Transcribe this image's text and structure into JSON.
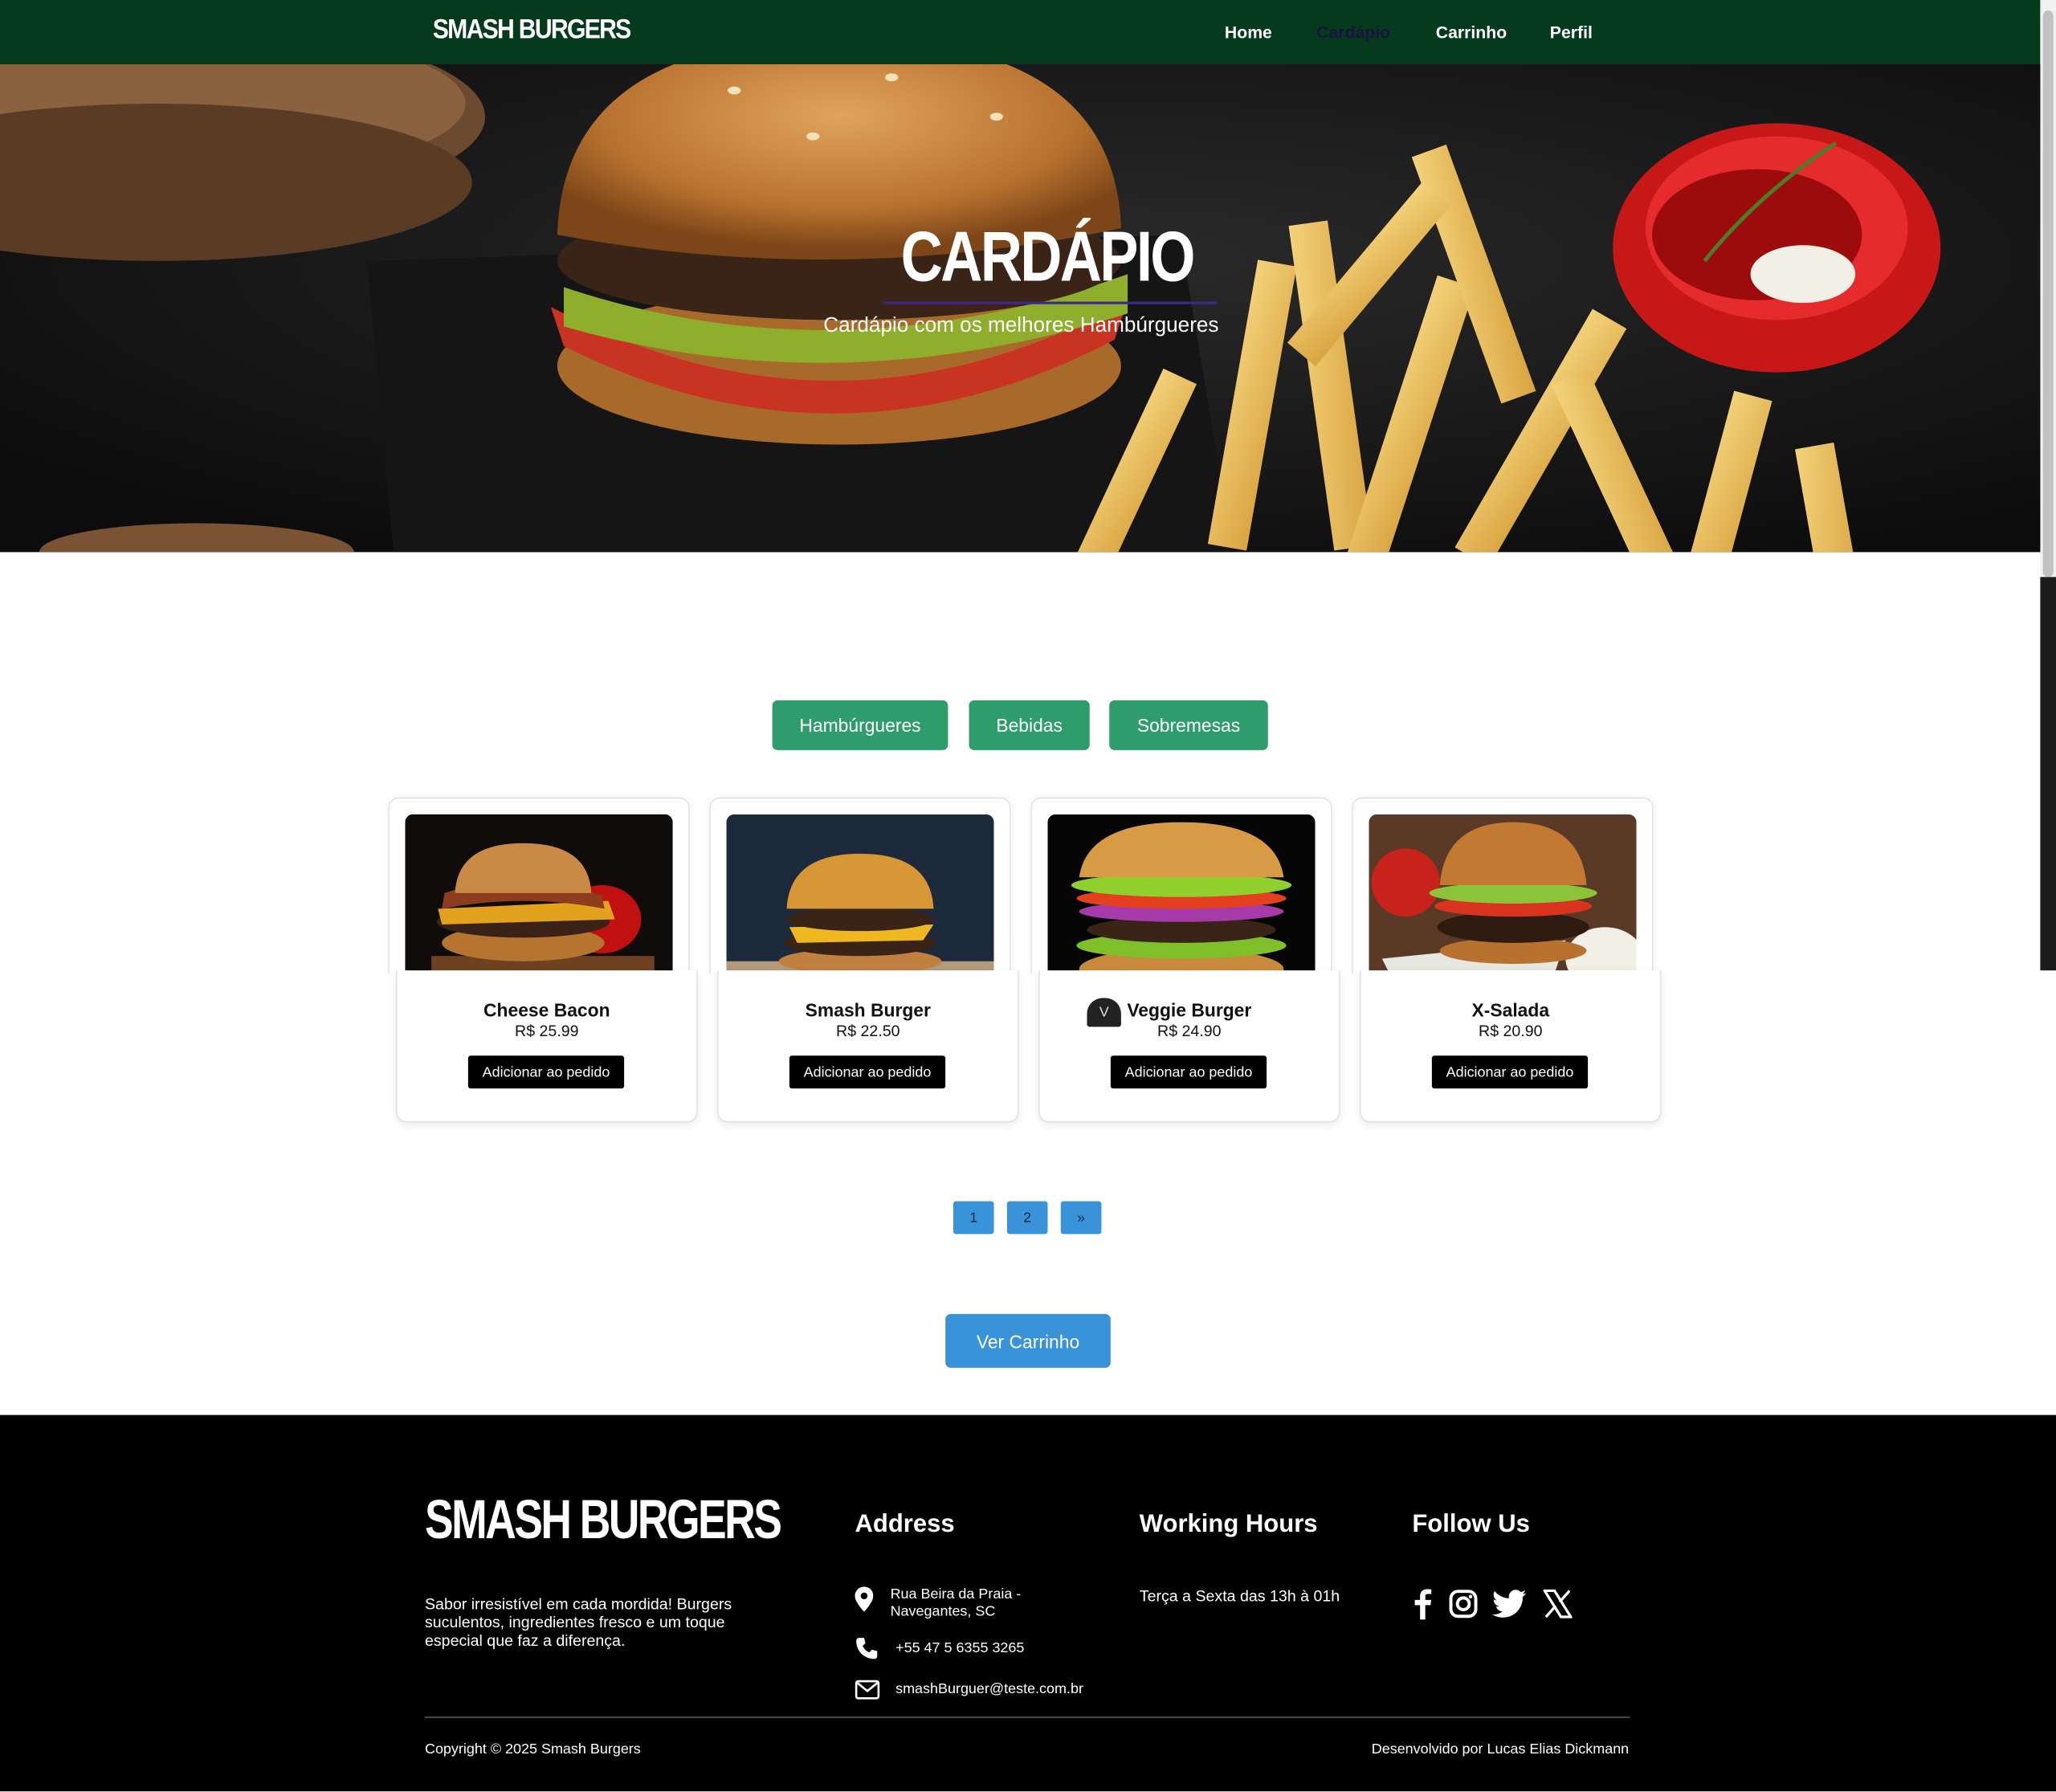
{
  "nav": {
    "logo": "SMASH BURGERS",
    "links": [
      "Home",
      "Cardápio",
      "Carrinho",
      "Perfil"
    ]
  },
  "hero": {
    "title": "CARDÁPIO",
    "subtitle": "Cardápio com os melhores Hambúrgueres"
  },
  "tabs": [
    "Hambúrgueres",
    "Bebidas",
    "Sobremesas"
  ],
  "products": [
    {
      "name": "Cheese Bacon",
      "price": "R$ 25.99",
      "button": "Adicionar ao pedido"
    },
    {
      "name": "Smash Burger",
      "price": "R$ 22.50",
      "button": "Adicionar ao pedido"
    },
    {
      "name": "Veggie Burger",
      "price": "R$ 24.90",
      "button": "Adicionar ao pedido"
    },
    {
      "name": "X-Salada",
      "price": "R$ 20.90",
      "button": "Adicionar ao pedido"
    }
  ],
  "badge": "V",
  "pagination": [
    "1",
    "2",
    "»"
  ],
  "cart_button": "Ver Carrinho",
  "footer": {
    "logo": "SMASH BURGERS",
    "tagline": "Sabor irresistível em cada mordida! Burgers suculentos, ingredientes fresco e um toque especial que faz a diferença.",
    "address_title": "Address",
    "address": "Rua Beira da Praia - Navegantes, SC",
    "phone": "+55 47 5 6355 3265",
    "email": "smashBurguer@teste.com.br",
    "hours_title": "Working Hours",
    "hours": "Terça a Sexta das 13h à 01h",
    "follow_title": "Follow Us",
    "copyright": "Copyright © 2025 Smash Burgers",
    "developer": "Desenvolvido por Lucas Elias Dickmann"
  },
  "colors": {
    "navbar": "#053a1d",
    "tab_green": "#2f9d6b",
    "blue": "#3a93d8",
    "footer": "#000000"
  }
}
